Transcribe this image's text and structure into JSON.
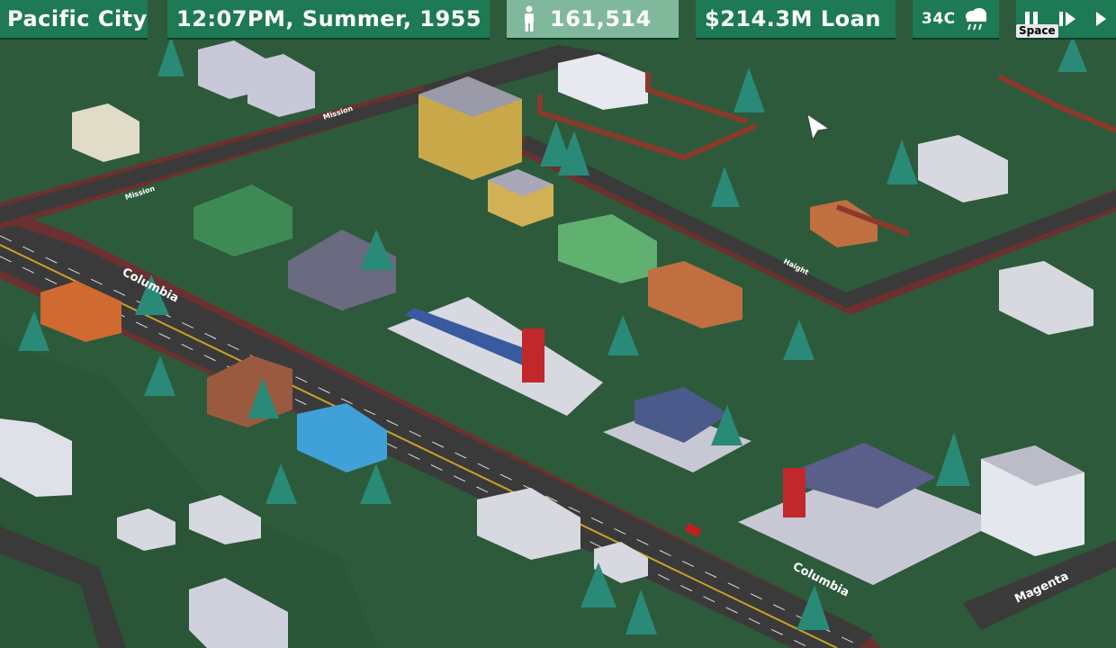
{
  "hud": {
    "city_name": "Pacific City",
    "datetime": "12:07PM, Summer, 1955",
    "population": "161,514",
    "funds": "$214.3M Loan",
    "temperature": "34C",
    "weather_icon": "rain-cloud-icon",
    "speed_key_label": "Space",
    "pause_icon": "pause-icon",
    "play_icon": "play-icon",
    "fast_icon": "fast-forward-icon"
  },
  "map": {
    "street_labels": [
      "Columbia",
      "Columbia",
      "Magenta",
      "Mission",
      "Mission",
      "Haight"
    ]
  },
  "colors": {
    "hud_dark": "#1e7a55",
    "hud_light": "#7fb89a",
    "grass": "#2d5a3a",
    "road": "#3a3a3a",
    "dirt_edge": "#6b3030"
  }
}
